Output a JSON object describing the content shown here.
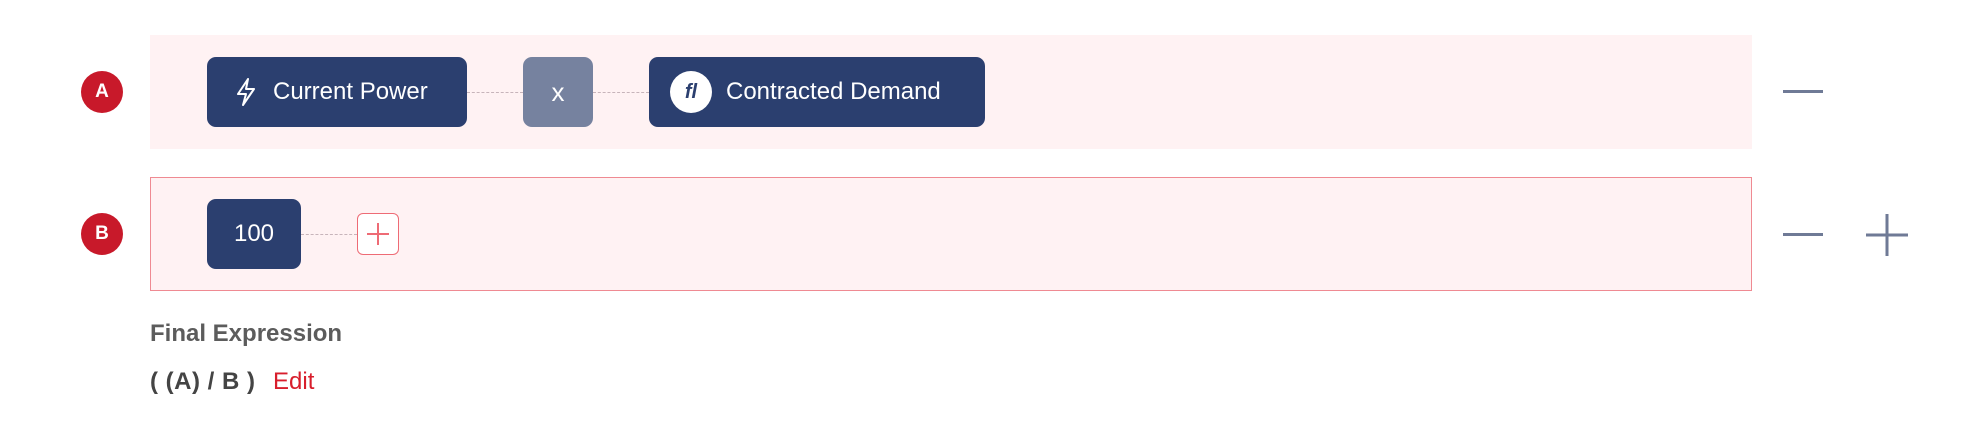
{
  "rows": [
    {
      "label": "A",
      "terms": {
        "left": {
          "icon": "lightning-icon",
          "label": "Current Power"
        },
        "operator": "x",
        "right": {
          "icon": "function-icon",
          "icon_text": "fl",
          "label": "Contracted Demand"
        }
      }
    },
    {
      "label": "B",
      "terms": {
        "value": "100"
      }
    }
  ],
  "final_expression": {
    "title": "Final Expression",
    "expression": "( (A) / B )",
    "edit_label": "Edit"
  },
  "colors": {
    "chip": "#2b3f6f",
    "operator_chip": "#76829f",
    "badge": "#c8192a",
    "row_bg": "#fff2f3",
    "accent": "#d81e2c"
  }
}
